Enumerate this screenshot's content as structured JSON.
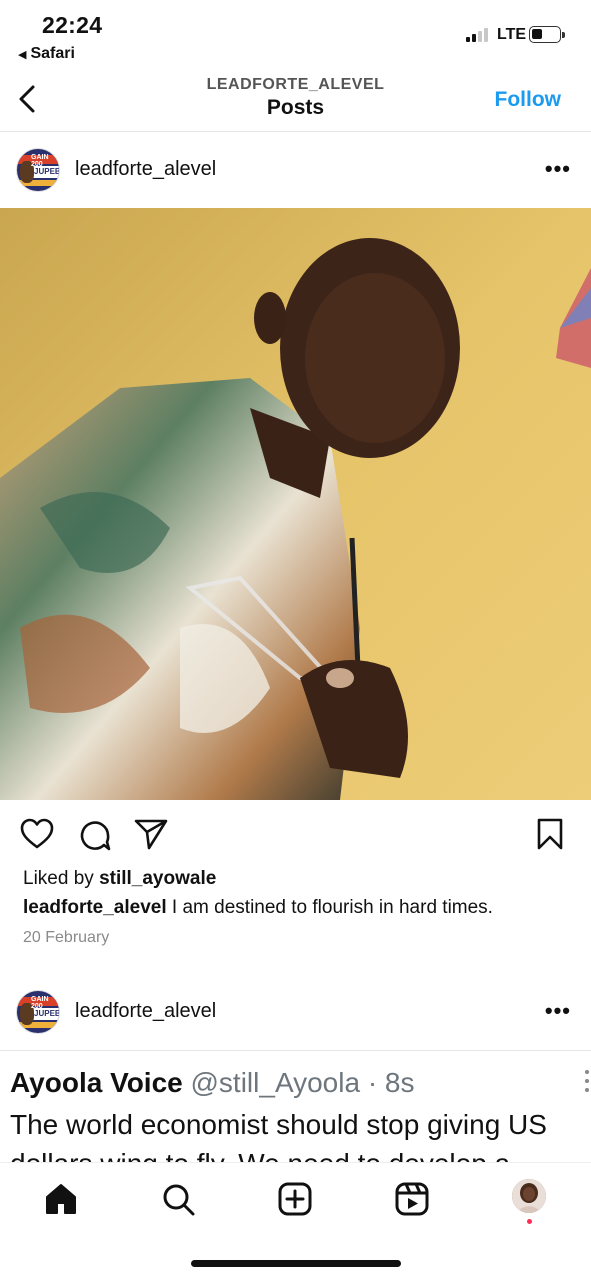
{
  "status_bar": {
    "time": "22:24",
    "back_app": "Safari",
    "network": "LTE"
  },
  "nav": {
    "username_caps": "LEADFORTE_ALEVEL",
    "title": "Posts",
    "follow_label": "Follow"
  },
  "posts": [
    {
      "username": "leadforte_alevel",
      "avatar_text_top": "GAIN 200",
      "avatar_text_mid": "JUPEB",
      "liked_by_prefix": "Liked by",
      "liked_by_user": "still_ayowale",
      "caption_user": "leadforte_alevel",
      "caption_text": " I am destined to flourish in hard times.",
      "date": "20 February"
    },
    {
      "username": "leadforte_alevel",
      "avatar_text_top": "GAIN 200",
      "avatar_text_mid": "JUPEB",
      "tweet": {
        "name": "Ayoola Voice",
        "handle": "@still_Ayoola · 8s",
        "line1": "The world economist should stop giving US",
        "line2": "dollars wing to fly. We need to develop a"
      }
    }
  ],
  "tabbar": {
    "tabs": [
      "home-icon",
      "search-icon",
      "create-icon",
      "reels-icon",
      "profile"
    ]
  },
  "colors": {
    "follow": "#1a9bf0",
    "notification_dot": "#ff2d55"
  }
}
